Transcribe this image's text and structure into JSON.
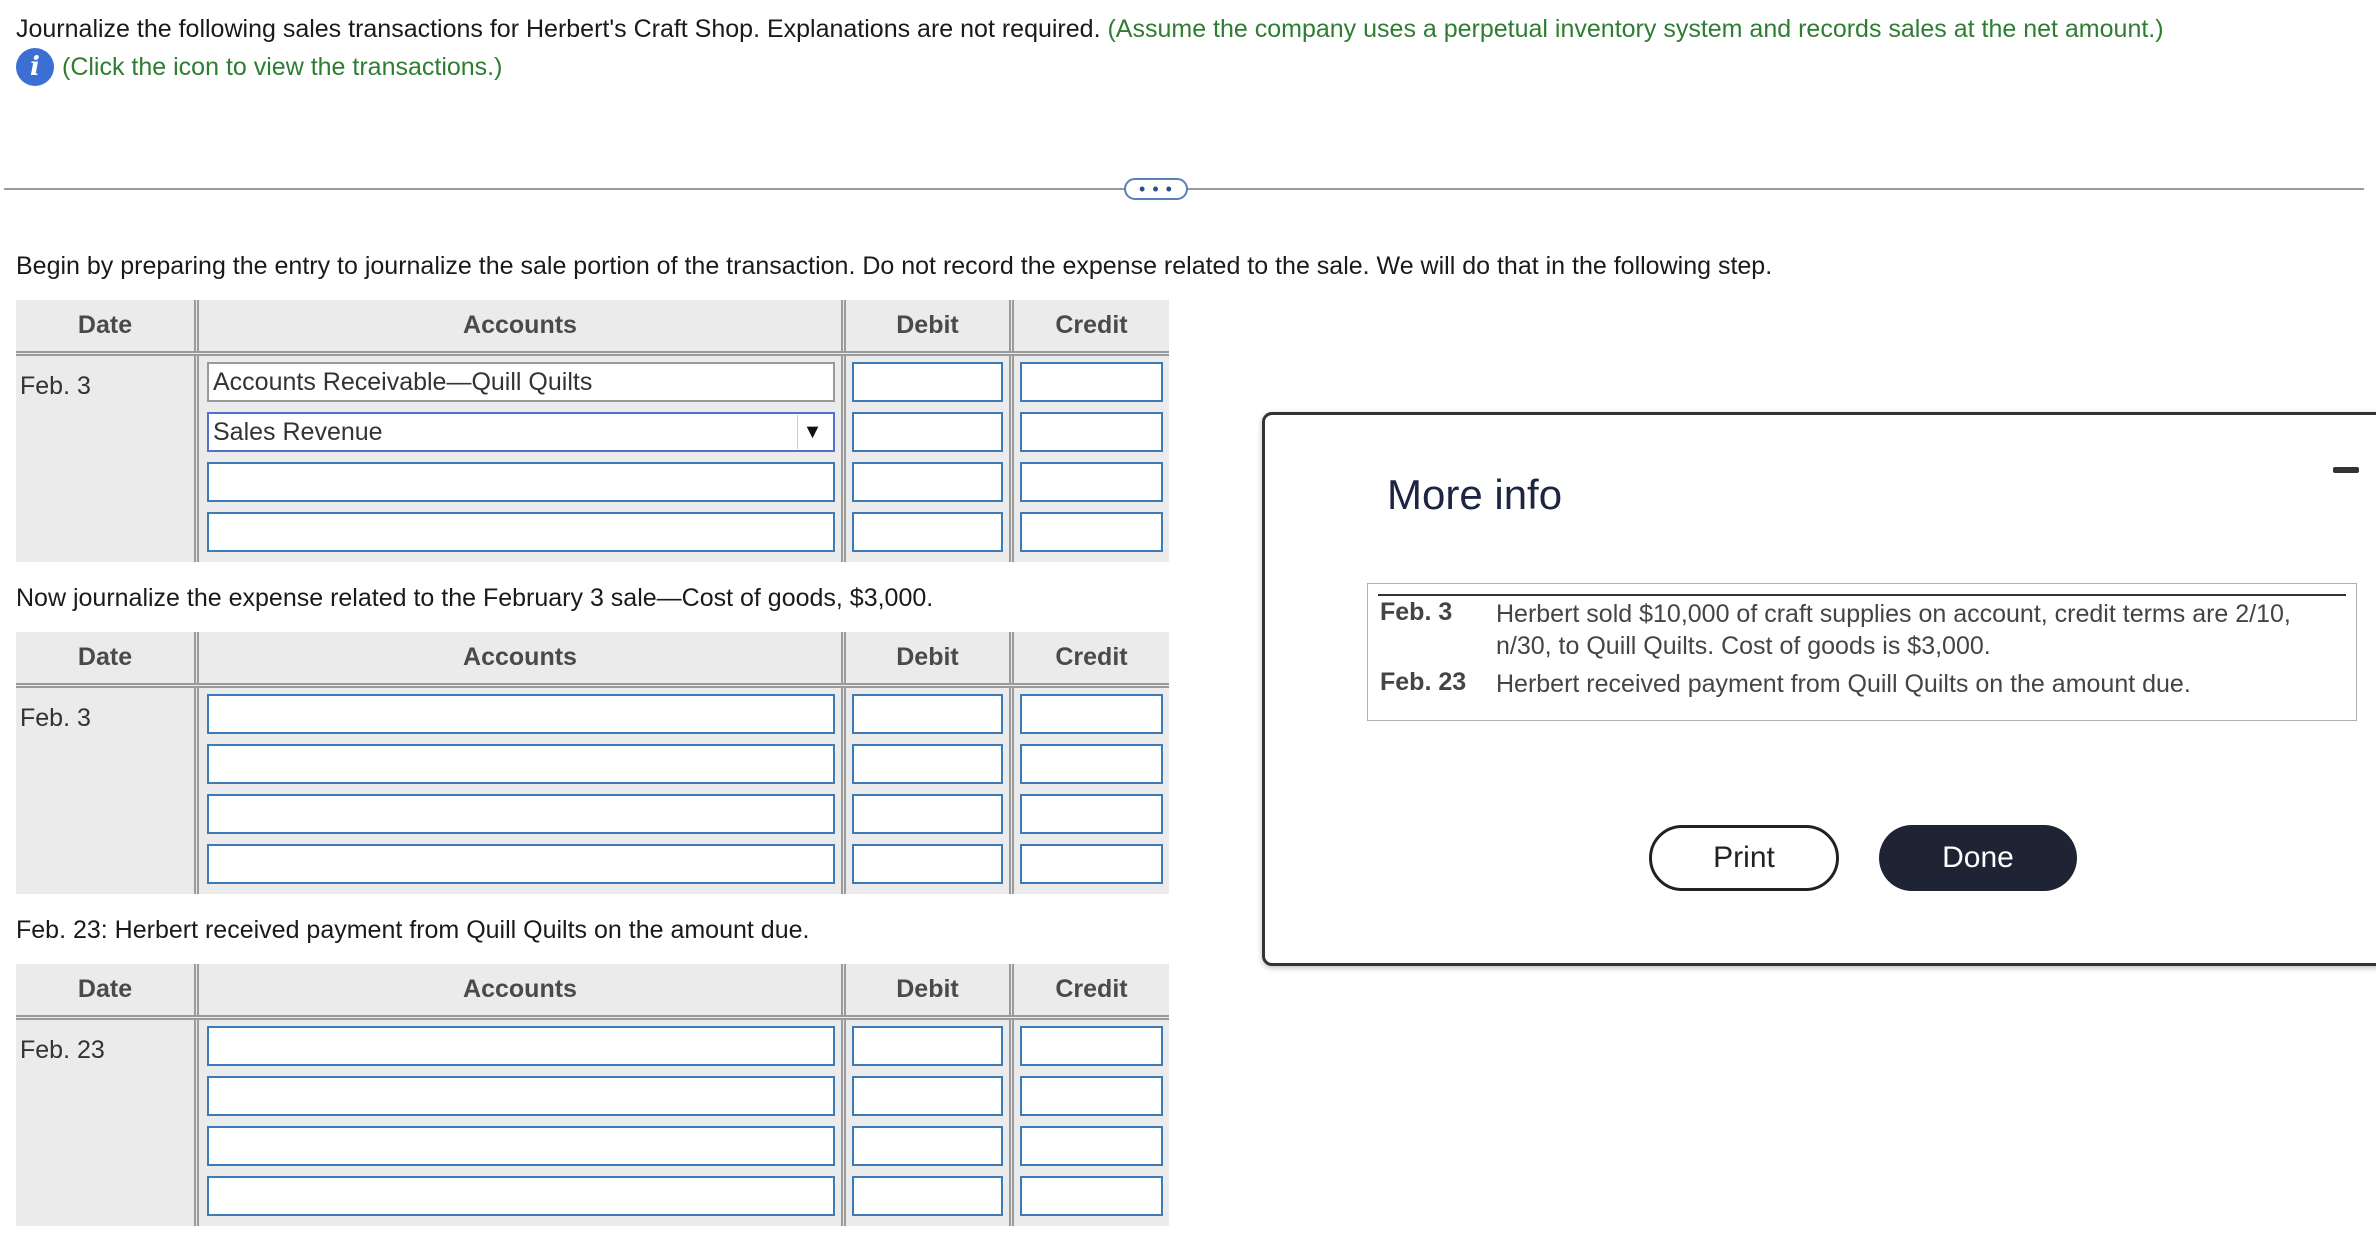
{
  "intro": {
    "main_text": "Journalize the following sales transactions for Herbert's Craft Shop. Explanations are not required.",
    "assumption": "(Assume the company uses a perpetual inventory system and records sales at the net amount.)",
    "info_link": "(Click the icon to view the transactions.)",
    "info_icon": "info-icon",
    "info_glyph": "i"
  },
  "expander_label": "• • •",
  "sections": [
    {
      "instruction": "Begin by preparing the entry to journalize the sale portion of the transaction. Do not record the expense related to the sale. We will do that in the following step.",
      "date": "Feb. 3",
      "accounts": [
        "Accounts Receivable—Quill Quilts",
        "Sales Revenue",
        "",
        ""
      ],
      "select_arrow": "▼"
    },
    {
      "instruction": "Now journalize the expense related to the February 3 sale—Cost of goods, $3,000.",
      "date": "Feb. 3",
      "accounts": [
        "",
        "",
        "",
        ""
      ]
    },
    {
      "instruction": "Feb. 23: Herbert received payment from Quill Quilts on the amount due.",
      "date": "Feb. 23",
      "accounts": [
        "",
        "",
        "",
        ""
      ]
    }
  ],
  "table_headers": {
    "date": "Date",
    "accounts": "Accounts",
    "debit": "Debit",
    "credit": "Credit"
  },
  "modal": {
    "title": "More info",
    "transactions": [
      {
        "date": "Feb. 3",
        "text": "Herbert sold $10,000 of craft supplies on account, credit terms are 2/10, n/30, to Quill Quilts. Cost of goods is $3,000."
      },
      {
        "date": "Feb. 23",
        "text": "Herbert received payment from Quill Quilts on the amount due."
      }
    ],
    "print_label": "Print",
    "done_label": "Done"
  },
  "colors": {
    "green_text": "#2e7d32",
    "input_border": "#3c7ab8",
    "done_bg": "#1e2433"
  }
}
